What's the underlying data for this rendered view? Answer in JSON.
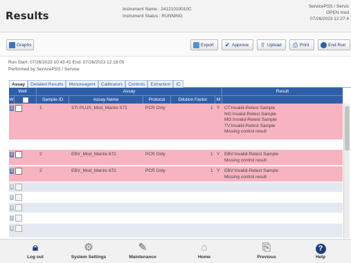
{
  "header": {
    "title": "Results",
    "instrument_name": "Instrument Name : 24121010010C",
    "instrument_status": "Instrument Status : RUNNING",
    "user": "ServicePSS / Servic",
    "mode": "OPEN mod",
    "datetime": "07/26/2023 12:27:4"
  },
  "toolbar": {
    "graphs": "Graphs",
    "export": "Export",
    "approve": "Approve",
    "upload": "Upload",
    "print": "Print",
    "end_run": "End Run"
  },
  "run": {
    "times": "Run  Start: 07/26/2023 10:43:41   End: 07/26/2023 12:19:05",
    "performed_by": "Performed by ServicePSS / Service"
  },
  "tabs": [
    "Assay",
    "Detailed Results",
    "Monoreagent",
    "Calibrators",
    "Controls",
    "Extraction",
    "IC"
  ],
  "table": {
    "group_headers": {
      "well": "Well",
      "assay": "Assay",
      "result": "Result"
    },
    "columns": {
      "w": "W",
      "sample_id": "Sample ID",
      "assay_name": "Assay Name",
      "protocol": "Protocol",
      "dilution": "Dilution Factor",
      "m": "M"
    },
    "rows": [
      {
        "num": "1",
        "sample_id": "1",
        "assay": "STI PLUS_Mod_Mantis 572",
        "protocol": "PCR Only",
        "dilution": "1",
        "m": "Y",
        "result": [
          "CT:Invalid-Retest Sample",
          "NG:Invalid-Retest Sample",
          "MG:Invalid-Retest Sample",
          "TV:Invalid-Retest Sample",
          "Missing control result"
        ]
      },
      {
        "num": "2",
        "sample_id": "2",
        "assay": "EBV_Mod_Mantis 672",
        "protocol": "PCR Only",
        "dilution": "1",
        "m": "Y",
        "result": [
          "EBV:Invalid-Retest Sample",
          "Missing control result"
        ]
      },
      {
        "num": "3",
        "sample_id": "2",
        "assay": "EBV_Mod_Mantis 672",
        "protocol": "PCR Only",
        "dilution": "1",
        "m": "Y",
        "result": [
          "EBV:Invalid-Retest Sample",
          "Missing control result"
        ]
      }
    ],
    "empty_rows": [
      "4",
      "5",
      "6",
      "7",
      "8"
    ]
  },
  "footer": {
    "log_out": "Log out",
    "system_settings": "System Settings",
    "maintenance": "Maintenance",
    "home": "Home",
    "previous": "Previous",
    "help": "Help"
  },
  "icons": {
    "log_out": "lock-icon",
    "system_settings": "gear-icon",
    "maintenance": "wrench-icon",
    "home": "home-icon",
    "previous": "previous-icon",
    "help": "help-icon"
  },
  "colors": {
    "header_blue": "#2f5ea8",
    "failed_row": "#f7b4c0",
    "empty_row": "#e4e9f1",
    "footer_icon_active": "#1d3f7c"
  }
}
